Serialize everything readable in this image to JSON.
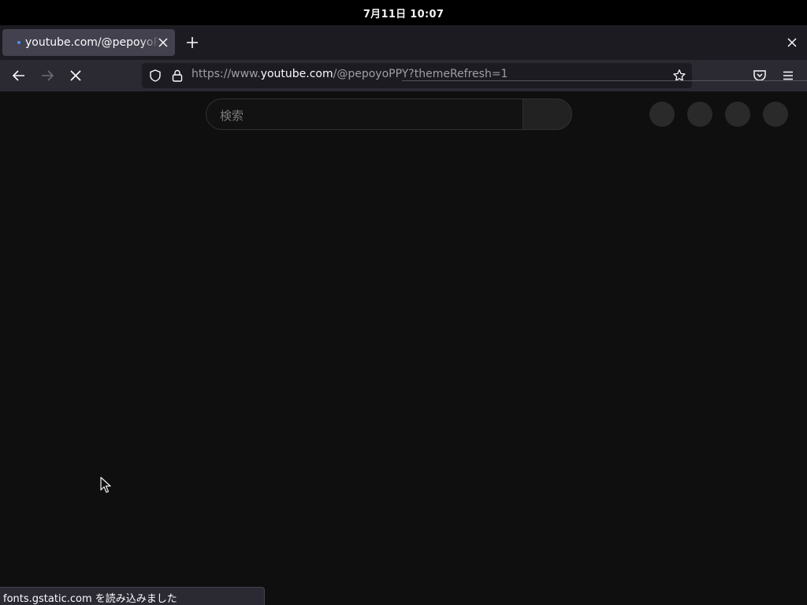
{
  "system_bar": {
    "clock": "7月11日 10:07"
  },
  "browser": {
    "tab": {
      "title": "youtube.com/@pepoyoPPY"
    },
    "url": {
      "scheme_prefix": "https://www.",
      "host": "youtube.com",
      "path": "/@pepoyoPPY?themeRefresh=1"
    },
    "status_text": "fonts.gstatic.com を読み込みました"
  },
  "page": {
    "search": {
      "placeholder": "検索"
    }
  },
  "icons": {
    "back": "arrow-left-icon",
    "forward": "arrow-right-icon",
    "stop": "stop-loading-icon",
    "tracking": "shield-icon",
    "lock": "lock-icon",
    "bookmark": "star-icon",
    "pocket": "pocket-icon",
    "menu": "hamburger-menu-icon",
    "new_tab": "plus-icon",
    "close_tab": "close-icon",
    "close_window": "close-icon"
  },
  "colors": {
    "page_bg": "#0f0f0f",
    "chrome_bg": "#2b2a33",
    "tab_active": "#42414d",
    "loading_dot": "#4e8df5"
  }
}
